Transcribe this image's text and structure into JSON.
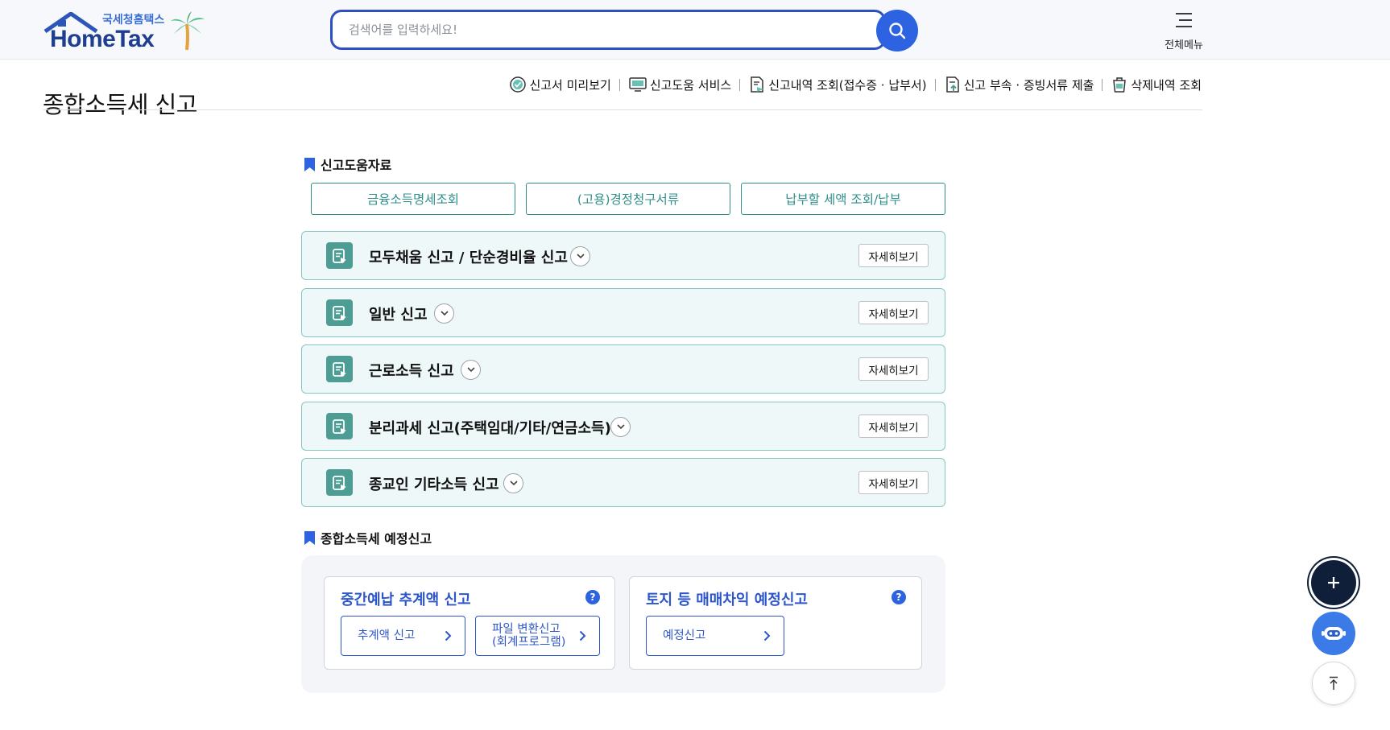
{
  "header": {
    "logo_sub": "국세청홈택스",
    "logo_main": "HomeTax",
    "search_placeholder": "검색어를 입력하세요!",
    "all_menu_label": "전체메뉴"
  },
  "page": {
    "title": "종합소득세 신고",
    "quick_links": [
      {
        "label": "신고서 미리보기",
        "icon": "check-circle-icon"
      },
      {
        "label": "신고도움 서비스",
        "icon": "monitor-icon"
      },
      {
        "label": "신고내역 조회(접수증 · 납부서)",
        "icon": "document-search-icon"
      },
      {
        "label": "신고 부속 · 증빙서류 제출",
        "icon": "document-upload-icon"
      },
      {
        "label": "삭제내역 조회",
        "icon": "trash-icon"
      }
    ]
  },
  "help_section": {
    "title": "신고도움자료",
    "buttons": [
      "금융소득명세조회",
      "(고용)경정청구서류",
      "납부할 세액 조회/납부"
    ]
  },
  "filing_types": [
    {
      "label": "모두채움 신고 / 단순경비율 신고",
      "detail": "자세히보기"
    },
    {
      "label": "일반 신고",
      "detail": "자세히보기"
    },
    {
      "label": "근로소득 신고",
      "detail": "자세히보기"
    },
    {
      "label": "분리과세 신고(주택임대/기타/연금소득)",
      "detail": "자세히보기"
    },
    {
      "label": "종교인 기타소득 신고",
      "detail": "자세히보기"
    }
  ],
  "pre_section": {
    "title": "종합소득세 예정신고",
    "cards": [
      {
        "title": "중간예납 추계액 신고",
        "help": "?",
        "buttons": [
          {
            "line1": "추계액 신고",
            "line2": ""
          },
          {
            "line1": "파일 변환신고",
            "line2": "(회계프로그램)"
          }
        ]
      },
      {
        "title": "토지 등 매매차익 예정신고",
        "help": "?",
        "buttons": [
          {
            "line1": "예정신고",
            "line2": ""
          }
        ]
      }
    ]
  },
  "colors": {
    "brand_blue": "#2d63e0",
    "teal": "#4e9d94",
    "teal_border": "#87c7c1",
    "card_title_blue": "#2c56c9"
  }
}
